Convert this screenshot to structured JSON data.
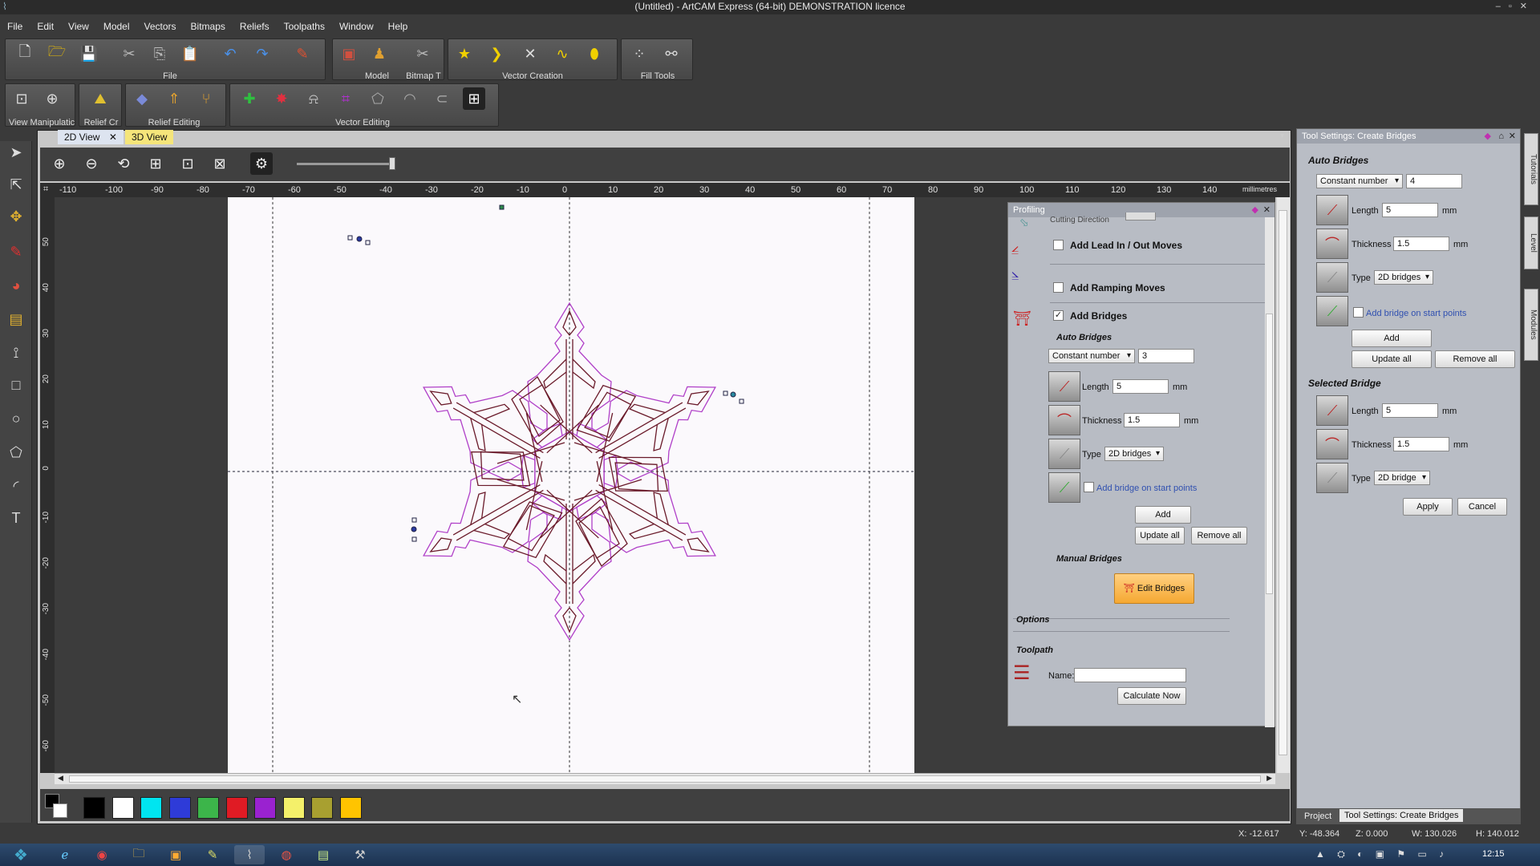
{
  "window": {
    "title": "(Untitled) - ArtCAM Express (64-bit) DEMONSTRATION licence"
  },
  "menu": [
    "File",
    "Edit",
    "View",
    "Model",
    "Vectors",
    "Bitmaps",
    "Reliefs",
    "Toolpaths",
    "Window",
    "Help"
  ],
  "toolbar_groups": {
    "file": "File",
    "model": "Model",
    "bitmap": "Bitmap T",
    "vector_creation": "Vector Creation",
    "fill_tools": "Fill Tools",
    "view_manipulation": "View Manipulatic",
    "relief_cr": "Relief Cr",
    "relief_editing": "Relief Editing",
    "vector_editing": "Vector Editing"
  },
  "tabs": {
    "view2d": "2D View",
    "view3d": "3D View"
  },
  "ruler": {
    "h_ticks": [
      "-110",
      "-100",
      "-90",
      "-80",
      "-70",
      "-60",
      "-50",
      "-40",
      "-30",
      "-20",
      "-10",
      "0",
      "10",
      "20",
      "30",
      "40",
      "50",
      "60",
      "70",
      "80",
      "90",
      "100",
      "110",
      "120",
      "130",
      "140"
    ],
    "units": "millimetres",
    "v_ticks": [
      "50",
      "40",
      "30",
      "20",
      "10",
      "0",
      "-10",
      "-20",
      "-30",
      "-40",
      "-50",
      "-60"
    ]
  },
  "palette": {
    "colors": [
      "#000000",
      "#ffffff",
      "#00e5f0",
      "#2e3bd8",
      "#3cb54a",
      "#e01b24",
      "#9a22d0",
      "#f4f06a",
      "#a8a030",
      "#ffc400"
    ]
  },
  "profiling": {
    "title": "Profiling",
    "cutting_direction": "Cutting Direction",
    "add_lead_in_out": "Add Lead In / Out Moves",
    "add_ramping": "Add Ramping Moves",
    "add_bridges": "Add Bridges",
    "add_bridges_checked": "✓",
    "auto_bridges": "Auto Bridges",
    "mode": "Constant number",
    "count": "3",
    "length_label": "Length",
    "length": "5",
    "length_unit": "mm",
    "thickness_label": "Thickness",
    "thickness": "1.5",
    "thickness_unit": "mm",
    "type_label": "Type",
    "type": "2D bridges",
    "bridge_on_start": "Add bridge on start points",
    "add": "Add",
    "update_all": "Update all",
    "remove_all": "Remove all",
    "manual_bridges": "Manual Bridges",
    "edit_bridges": "Edit Bridges",
    "options": "Options",
    "toolpath": "Toolpath",
    "name_label": "Name:",
    "name_value": "",
    "calculate": "Calculate Now"
  },
  "tool_settings": {
    "title": "Tool Settings: Create Bridges",
    "auto_bridges": "Auto Bridges",
    "mode": "Constant number",
    "count": "4",
    "length_label": "Length",
    "length": "5",
    "length_unit": "mm",
    "thickness_label": "Thickness",
    "thickness": "1.5",
    "thickness_unit": "mm",
    "type_label": "Type",
    "type": "2D bridges",
    "bridge_on_start": "Add bridge on start points",
    "add": "Add",
    "update_all": "Update all",
    "remove_all": "Remove all",
    "selected_bridge": "Selected Bridge",
    "sel_length": "5",
    "sel_thickness": "1.5",
    "sel_type": "2D bridge",
    "apply": "Apply",
    "cancel": "Cancel"
  },
  "side_tabs": [
    "Tutorials",
    "Level",
    "Modules"
  ],
  "bottom_tabs": {
    "project": "Project",
    "tool_settings": "Tool Settings: Create Bridges"
  },
  "status": {
    "x": "X: -12.617",
    "y": "Y: -48.364",
    "z": "Z: 0.000",
    "w": "W: 130.026",
    "h": "H: 140.012"
  },
  "clock": "12:15"
}
